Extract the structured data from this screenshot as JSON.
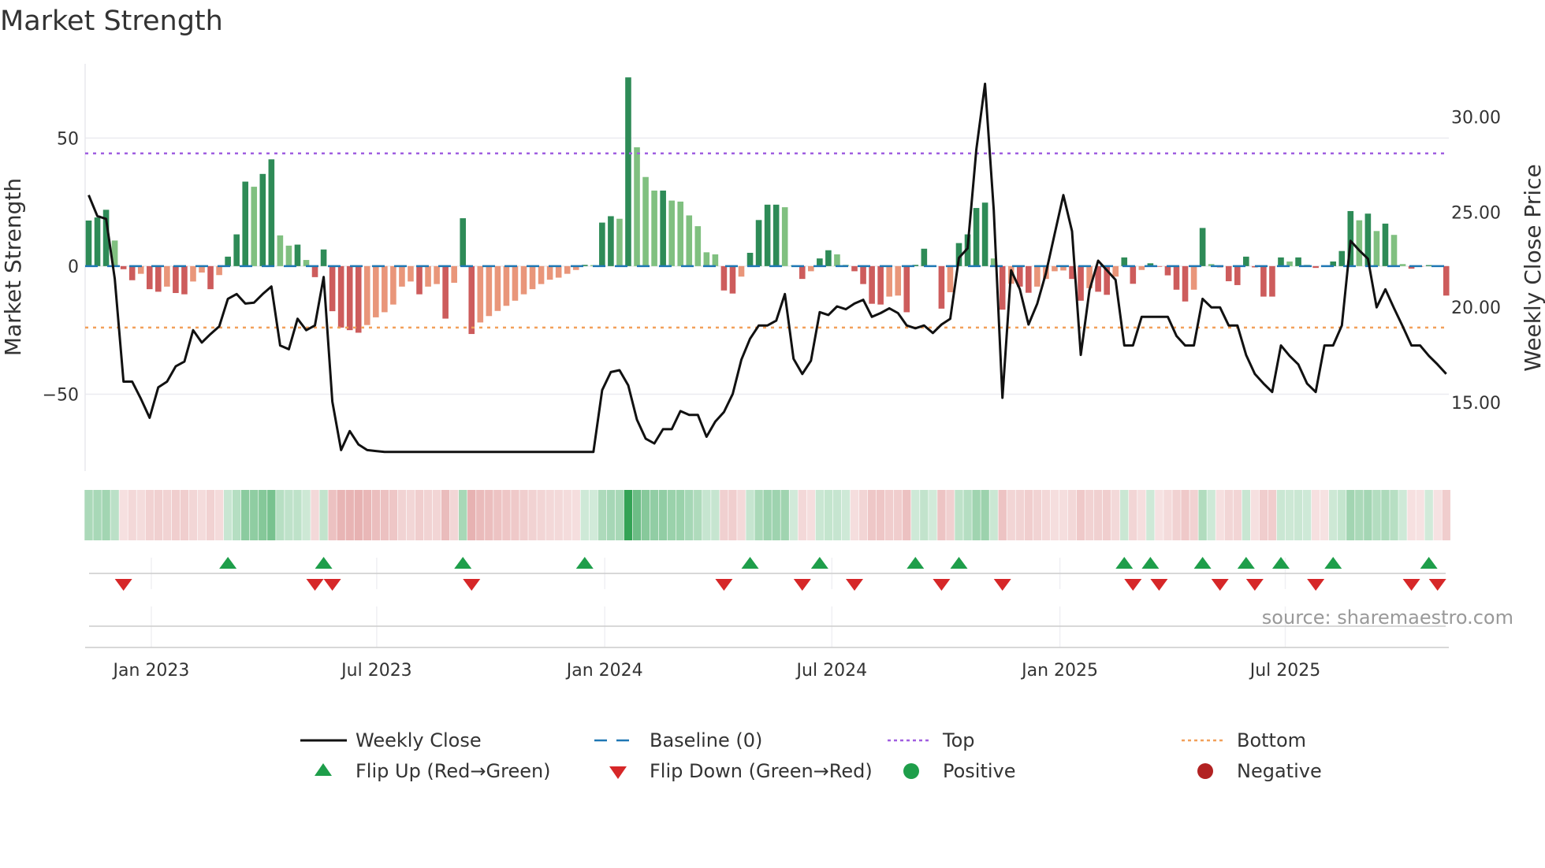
{
  "chart_data": {
    "type": "bar+line",
    "title": "Market Strength",
    "ylabel_left": "Market Strength",
    "ylabel_right": "Weekly Close Price",
    "source": "source: sharemaestro.com",
    "ylim_left": [
      -80,
      79
    ],
    "ylim_right": [
      11.4,
      32.8
    ],
    "left_ticks": [
      {
        "value": 50,
        "label": "50"
      },
      {
        "value": 0,
        "label": "0"
      },
      {
        "value": -50,
        "label": "−50"
      }
    ],
    "right_ticks": [
      {
        "value": 30,
        "label": "30.00"
      },
      {
        "value": 25,
        "label": "25.00"
      },
      {
        "value": 20,
        "label": "20.00"
      },
      {
        "value": 15,
        "label": "15.00"
      }
    ],
    "x_ticks": [
      {
        "label": "Jan 2023",
        "week": 7.2
      },
      {
        "label": "Jul 2023",
        "week": 33.1
      },
      {
        "label": "Jan 2024",
        "week": 59.3
      },
      {
        "label": "Jul 2024",
        "week": 85.4
      },
      {
        "label": "Jan 2025",
        "week": 111.6
      },
      {
        "label": "Jul 2025",
        "week": 137.5
      }
    ],
    "top_level": 44,
    "bottom_level": -24,
    "baseline": 0,
    "strength": [
      17.8,
      19,
      22,
      10,
      -1.2,
      -5.5,
      -3,
      -9,
      -10,
      -8,
      -10.5,
      -11,
      -6,
      -2.5,
      -9,
      -3.5,
      3.7,
      12.4,
      33,
      31,
      36,
      41.7,
      12,
      8,
      8.4,
      2.4,
      -4.3,
      6.5,
      -17.6,
      -24,
      -25,
      -26,
      -23,
      -20,
      -18,
      -15,
      -8,
      -6,
      -11,
      -8,
      -7,
      -20.5,
      -6.5,
      18.7,
      -26.5,
      -22,
      -19.5,
      -17.5,
      -15.5,
      -13.5,
      -11,
      -9,
      -7,
      -5.3,
      -4.5,
      -3,
      -1.5,
      0.5,
      0.4,
      17,
      19.5,
      18.5,
      73.7,
      46.4,
      34.8,
      29.5,
      29.5,
      25.6,
      25.2,
      19.8,
      15.6,
      5.4,
      4.6,
      -9.5,
      -10.7,
      -4.1,
      5.2,
      18,
      24,
      24,
      23,
      0.3,
      -5,
      -2,
      3,
      6.2,
      4.6,
      0.5,
      -2,
      -7,
      -14.7,
      -15,
      -11.9,
      -11.5,
      -18,
      0.5,
      6.8,
      0.3,
      -16.6,
      -10.2,
      9,
      12.4,
      22.7,
      24.8,
      3,
      -17,
      -6.9,
      -8,
      -10.4,
      -8,
      -5,
      -2,
      -1.7,
      -5,
      -13.5,
      -8.6,
      -10,
      -11.2,
      -4.1,
      3.4,
      -6.9,
      -1.5,
      1.1,
      -0.2,
      -3.6,
      -9.2,
      -13.8,
      -9.2,
      14.9,
      0.8,
      -0.5,
      -5.9,
      -7.4,
      3.7,
      -0.5,
      -11.9,
      -11.9,
      3.4,
      1.8,
      3.4,
      0.5,
      -0.7,
      -0.3,
      1.8,
      5.9,
      21.5,
      17.9,
      20.5,
      13.7,
      16.6,
      12.2,
      0.8,
      -1,
      -0.3,
      0.4,
      -0.3,
      -11.5
    ],
    "weekly_close": [
      25.9,
      24.8,
      24.65,
      21.5,
      16.1,
      16.1,
      15.2,
      14.2,
      15.8,
      16.1,
      16.9,
      17.15,
      18.8,
      18.15,
      18.6,
      19,
      20.45,
      20.7,
      20.2,
      20.25,
      20.7,
      21.1,
      18,
      17.8,
      19.4,
      18.8,
      19.05,
      21.6,
      15.05,
      12.5,
      13.5,
      12.8,
      12.5,
      12.45,
      12.4,
      12.4,
      12.4,
      12.4,
      12.4,
      12.4,
      12.4,
      12.4,
      12.4,
      12.4,
      12.4,
      12.4,
      12.4,
      12.4,
      12.4,
      12.4,
      12.4,
      12.4,
      12.4,
      12.4,
      12.4,
      12.4,
      12.4,
      12.4,
      12.4,
      15.65,
      16.6,
      16.7,
      15.9,
      14.1,
      13.1,
      12.85,
      13.6,
      13.6,
      14.55,
      14.35,
      14.35,
      13.2,
      14.0,
      14.5,
      15.45,
      17.25,
      18.35,
      19.05,
      19.05,
      19.3,
      20.7,
      17.3,
      16.5,
      17.2,
      19.75,
      19.6,
      20.05,
      19.9,
      20.2,
      20.4,
      19.5,
      19.7,
      19.95,
      19.7,
      19.05,
      18.9,
      19.05,
      18.65,
      19.1,
      19.4,
      22.6,
      23.1,
      28.3,
      31.75,
      25.1,
      15.25,
      21.95,
      20.95,
      19.1,
      20.2,
      21.8,
      23.85,
      25.9,
      24.0,
      17.5,
      20.9,
      22.45,
      21.95,
      21.45,
      18,
      18,
      19.5,
      19.5,
      19.5,
      19.5,
      18.5,
      18,
      18,
      20.45,
      20,
      20,
      19.05,
      19.05,
      17.5,
      16.5,
      16.0,
      15.55,
      18,
      17.45,
      17.0,
      16.0,
      15.55,
      18,
      18,
      19.05,
      23.5,
      23.0,
      22.55,
      20,
      20.95,
      19.95,
      19,
      18,
      18,
      17.45,
      17.0,
      16.5
    ],
    "colors": {
      "pos_rising": "#2e8b57",
      "pos_falling": "#80c080",
      "neg_falling": "#cd5c5c",
      "neg_rising": "#e9967a",
      "line": "#111111",
      "baseline": "#1f77b4",
      "top": "#a05fe0",
      "bottom": "#f2a05a",
      "flip_up": "#1e9e4a",
      "flip_down": "#d62728",
      "positive": "#1e9e4a",
      "negative": "#b22222"
    },
    "legend": {
      "weekly_close": "Weekly Close",
      "baseline": "Baseline (0)",
      "top": "Top",
      "bottom": "Bottom",
      "flip_up": "Flip Up (Red→Green)",
      "flip_down": "Flip Down (Green→Red)",
      "positive": "Positive",
      "negative": "Negative"
    },
    "legend_placement": "bottom"
  }
}
